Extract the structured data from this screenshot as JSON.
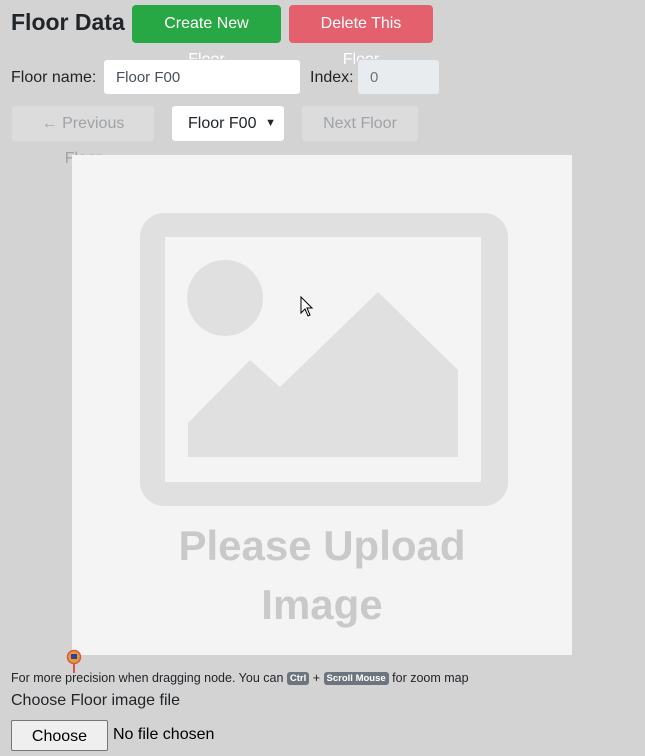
{
  "header": {
    "title": "Floor Data",
    "create_label": "Create New Floor",
    "delete_label": "Delete This Floor"
  },
  "form": {
    "name_label": "Floor name:",
    "name_value": "Floor F00",
    "index_label": "Index:",
    "index_value": "0"
  },
  "navigation": {
    "prev_label": "← Previous Floor",
    "selected_floor": "Floor F00",
    "next_label": "Next Floor →"
  },
  "map": {
    "placeholder_line1": "Please Upload",
    "placeholder_line2": "Image",
    "placeholder_icon": "image-placeholder-icon"
  },
  "hint": {
    "prefix": "For more precision when dragging node. You can",
    "key1": "Ctrl",
    "plus": "+",
    "key2": "Scroll Mouse",
    "suffix": "for zoom map"
  },
  "upload": {
    "label": "Choose Floor image file",
    "button_label": "Choose File",
    "status": "No file chosen"
  },
  "colors": {
    "create": "#28a745",
    "delete": "#e4606d",
    "background": "#d3d3d3",
    "map_bg": "#f4f4f4",
    "placeholder": "#e0e0e0"
  }
}
